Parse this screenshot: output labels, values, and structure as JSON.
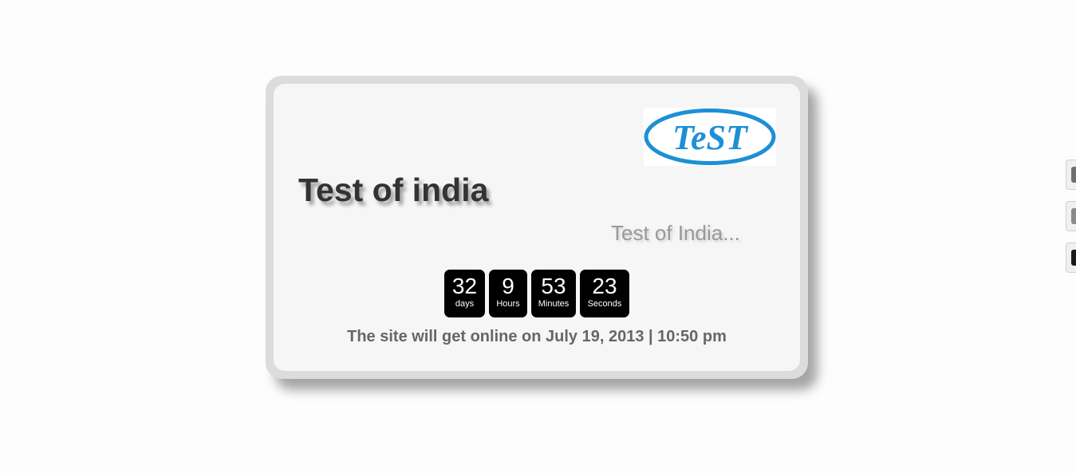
{
  "logo": {
    "text": "TeST",
    "color": "#1e8fd6",
    "icon": "test-logo-icon"
  },
  "site": {
    "title": "Test of india",
    "tagline": "Test of India..."
  },
  "countdown": {
    "days": {
      "value": "32",
      "unit": "days"
    },
    "hours": {
      "value": "9",
      "unit": "Hours"
    },
    "minutes": {
      "value": "53",
      "unit": "Minutes"
    },
    "seconds": {
      "value": "23",
      "unit": "Seconds"
    }
  },
  "online_message": "The site will get online on July 19, 2013 | 10:50 pm",
  "side_tabs": [
    {
      "icon": "social-icon-1"
    },
    {
      "icon": "social-icon-2"
    },
    {
      "icon": "social-icon-3"
    }
  ],
  "colors": {
    "title": "#333333",
    "tagline": "#999999",
    "countdown_bg": "#000000",
    "message": "#666666",
    "card_border": "#dcdcdc",
    "card_bg": "#f6f6f6"
  }
}
